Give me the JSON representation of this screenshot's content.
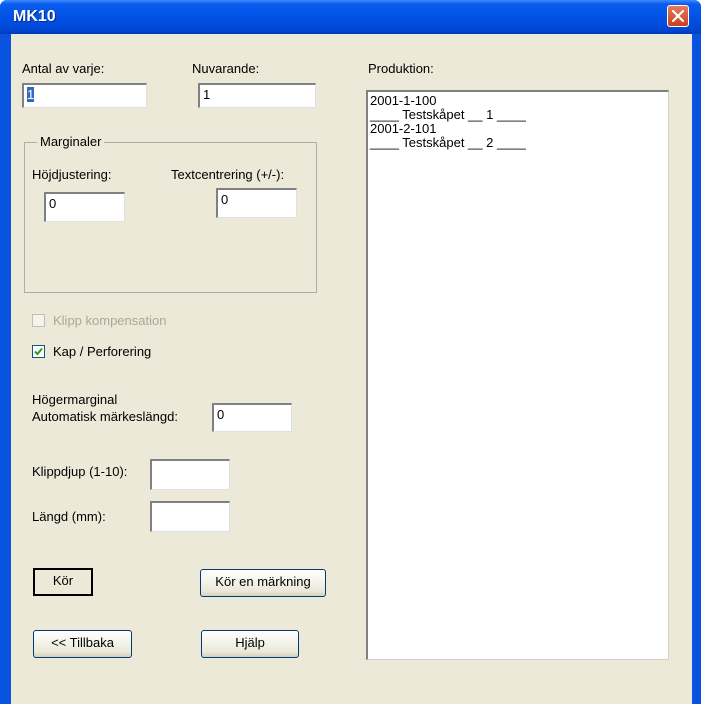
{
  "window": {
    "title": "MK10"
  },
  "fields": {
    "antal_label": "Antal av varje:",
    "antal_value": "1",
    "nuvarande_label": "Nuvarande:",
    "nuvarande_value": "1",
    "marginaler_label": "Marginaler",
    "hojd_label": "Höjdjustering:",
    "hojd_value": "0",
    "textcentrering_label": "Textcentrering (+/-):",
    "textcentrering_value": "0",
    "klipp_komp_label": "Klipp kompensation",
    "klipp_komp_checked": false,
    "kap_label": "Kap / Perforering",
    "kap_checked": true,
    "hogermarginal_label": "Högermarginal",
    "auto_label": "Automatisk märkeslängd:",
    "auto_value": "0",
    "klippdjup_label": "Klippdjup (1-10):",
    "klippdjup_value": "",
    "langd_label": "Längd (mm):",
    "langd_value": ""
  },
  "buttons": {
    "kor": "Kör",
    "kor_en": "Kör en märkning",
    "tillbaka": "<< Tillbaka",
    "hjalp": "Hjälp"
  },
  "produktion": {
    "label": "Produktion:",
    "items": [
      "2001-1-100",
      "____ Testskåpet __ 1 ____",
      "2001-2-101",
      "____ Testskåpet __ 2 ____"
    ]
  }
}
